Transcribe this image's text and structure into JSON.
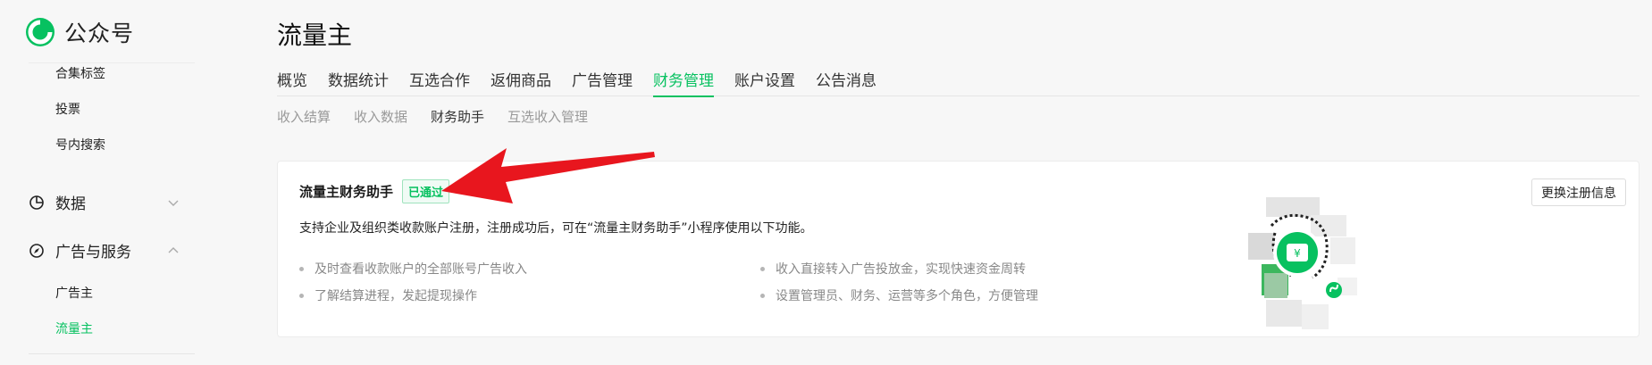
{
  "sidebar": {
    "logo_text": "公众号",
    "items_top": [
      "合集标签",
      "投票",
      "号内搜索"
    ],
    "group_data": "数据",
    "group_ads": "广告与服务",
    "ads_items": [
      "广告主",
      "流量主"
    ],
    "active_item": "流量主"
  },
  "main": {
    "title": "流量主",
    "tabs": [
      "概览",
      "数据统计",
      "互选合作",
      "返佣商品",
      "广告管理",
      "财务管理",
      "账户设置",
      "公告消息"
    ],
    "active_tab": "财务管理",
    "subtabs": [
      "收入结算",
      "收入数据",
      "财务助手",
      "互选收入管理"
    ],
    "active_subtab": "财务助手"
  },
  "card": {
    "title": "流量主财务助手",
    "badge": "已通过",
    "description": "支持企业及组织类收款账户注册，注册成功后，可在“流量主财务助手”小程序使用以下功能。",
    "features_left": [
      "及时查看收款账户的全部账号广告收入",
      "了解结算进程，发起提现操作"
    ],
    "features_right": [
      "收入直接转入广告投放金，实现快速资金周转",
      "设置管理员、财务、运营等多个角色，方便管理"
    ],
    "action_button": "更换注册信息",
    "qr_icon": "mini-program-qr-code"
  },
  "annotation": {
    "icon": "red-arrow-pointer"
  },
  "colors": {
    "accent": "#07c160",
    "arrow": "#e8161e"
  }
}
